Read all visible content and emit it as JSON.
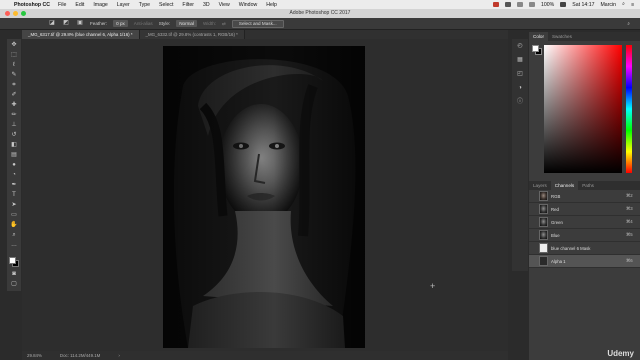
{
  "menubar": {
    "app_name": "Photoshop CC",
    "items": [
      "File",
      "Edit",
      "Image",
      "Layer",
      "Type",
      "Select",
      "Filter",
      "3D",
      "View",
      "Window",
      "Help"
    ],
    "battery": "100%",
    "clock": "Sat 14:17",
    "user": "Marcin"
  },
  "window": {
    "title": "Adobe Photoshop CC 2017"
  },
  "options_bar": {
    "feather_label": "Feather:",
    "feather_value": "0 px",
    "antialias_label": "Anti-alias",
    "style_label": "Style:",
    "style_value": "Normal",
    "width_label": "Width:",
    "select_mask_label": "Select and Mask..."
  },
  "doc_tabs": [
    {
      "label": "_MG_6317.tif @ 29.8% (blue channel 6, Alpha 1/16) *",
      "active": true
    },
    {
      "label": "_MG_6332.tif @ 29.8% (contrasts 1, RGB/16) *",
      "active": false
    }
  ],
  "right_panel": {
    "color_tabs": [
      "Color",
      "Swatches"
    ],
    "layer_tabs": [
      "Layers",
      "Channels",
      "Paths"
    ],
    "channels": [
      {
        "name": "RGB",
        "shortcut": "⌘2",
        "thumb": "face",
        "visible": true,
        "selected": false
      },
      {
        "name": "Red",
        "shortcut": "⌘3",
        "thumb": "face-gray",
        "visible": true,
        "selected": false
      },
      {
        "name": "Green",
        "shortcut": "⌘4",
        "thumb": "face-gray",
        "visible": true,
        "selected": false
      },
      {
        "name": "Blue",
        "shortcut": "⌘5",
        "thumb": "face-gray",
        "visible": true,
        "selected": false
      },
      {
        "name": "blue channel 6 Mask",
        "shortcut": "",
        "thumb": "white",
        "visible": false,
        "selected": false
      },
      {
        "name": "Alpha 1",
        "shortcut": "⌘6",
        "thumb": "dark",
        "visible": true,
        "selected": true
      }
    ]
  },
  "status_bar": {
    "zoom": "29.84%",
    "doc_size": "Doc: 114.2M/449.1M"
  },
  "watermark": "Udemy",
  "colors": {
    "menubar_bg": "#ececec",
    "panel_bg": "#3c3c3c",
    "canvas_bg": "#2d2d2d",
    "selected_row": "#545454",
    "mac_close": "#ff5f57",
    "mac_min": "#febc2e",
    "mac_max": "#28c840"
  }
}
